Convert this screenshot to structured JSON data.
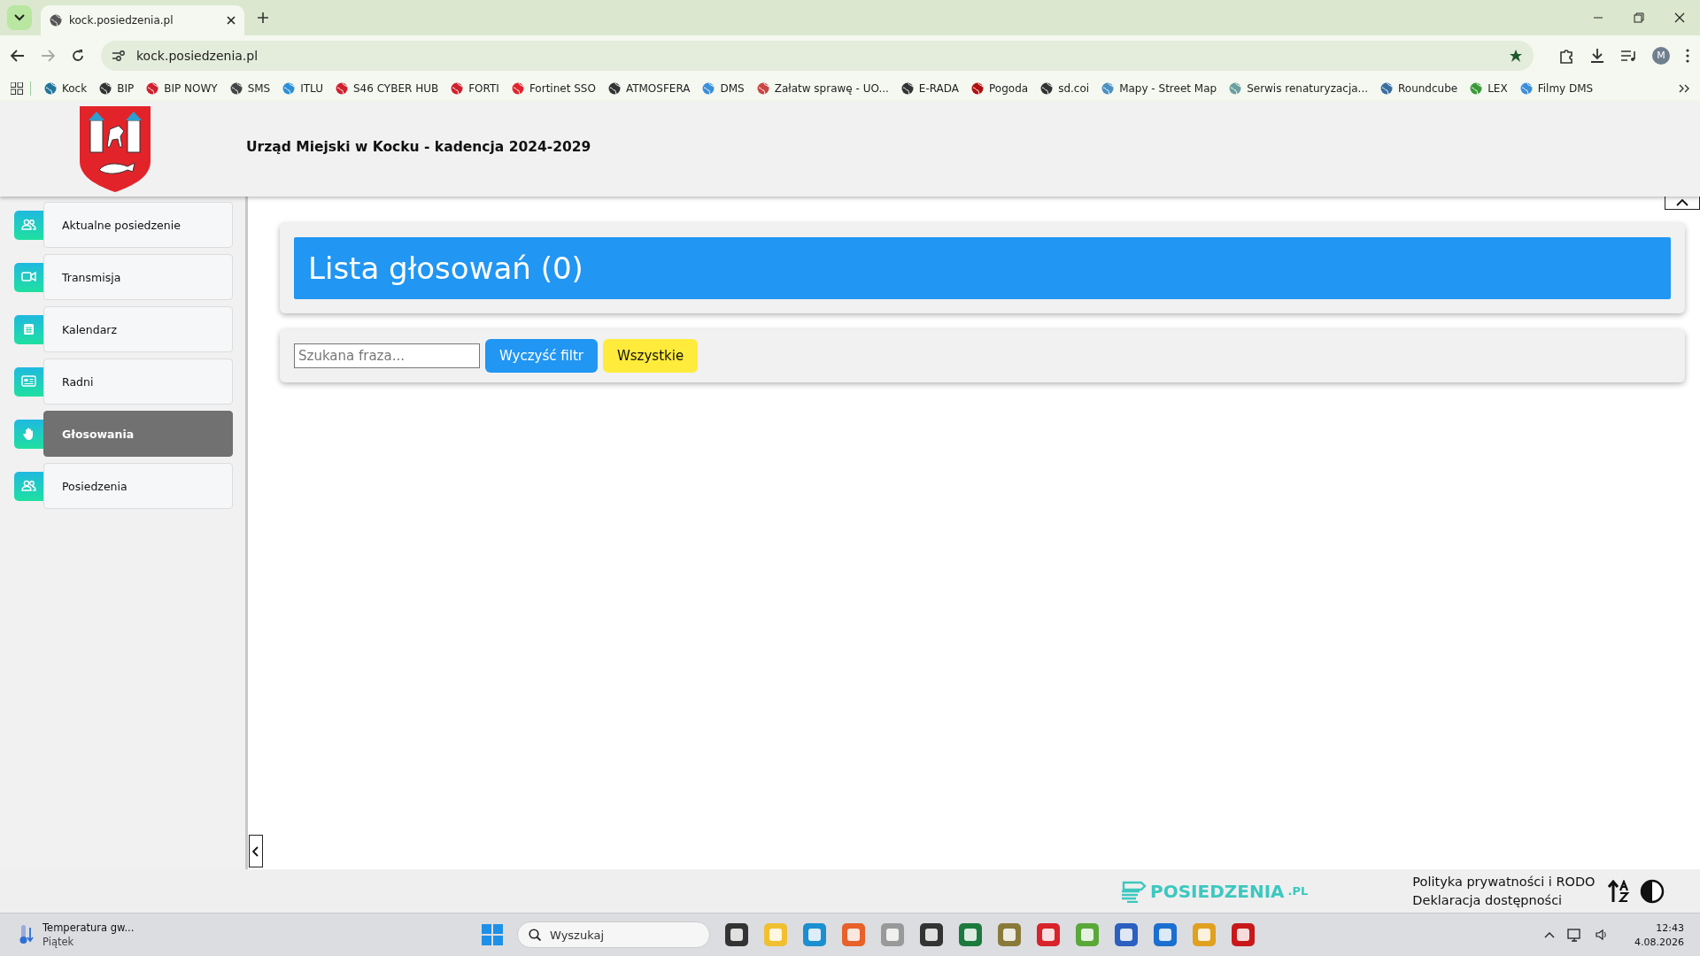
{
  "browser": {
    "tab_title": "kock.posiedzenia.pl",
    "address": "kock.posiedzenia.pl",
    "bookmarks": [
      {
        "label": "Kock"
      },
      {
        "label": "BIP"
      },
      {
        "label": "BIP NOWY"
      },
      {
        "label": "SMS"
      },
      {
        "label": "ITLU"
      },
      {
        "label": "S46 CYBER HUB"
      },
      {
        "label": "FORTI"
      },
      {
        "label": "Fortinet SSO"
      },
      {
        "label": "ATMOSFERA"
      },
      {
        "label": "DMS"
      },
      {
        "label": "Załatw sprawę - UO..."
      },
      {
        "label": "E-RADA"
      },
      {
        "label": "Pogoda"
      },
      {
        "label": "sd.coi"
      },
      {
        "label": "Mapy - Street Map"
      },
      {
        "label": "Serwis renaturyzacja..."
      },
      {
        "label": "Roundcube"
      },
      {
        "label": "LEX"
      },
      {
        "label": "Filmy DMS"
      }
    ],
    "profile_initial": "M"
  },
  "header": {
    "title": "Urząd Miejski w Kocku - kadencja 2024-2029"
  },
  "sidebar": {
    "items": [
      {
        "label": "Aktualne posiedzenie",
        "selected": false
      },
      {
        "label": "Transmisja",
        "selected": false
      },
      {
        "label": "Kalendarz",
        "selected": false
      },
      {
        "label": "Radni",
        "selected": false
      },
      {
        "label": "Głosowania",
        "selected": true
      },
      {
        "label": "Posiedzenia",
        "selected": false
      }
    ]
  },
  "main": {
    "title": "Lista głosowań (0)",
    "search": {
      "placeholder": "Szukana fraza..."
    },
    "buttons": [
      {
        "label": "Wyczyść filtr",
        "kind": "primary"
      },
      {
        "label": "Wszystkie",
        "kind": "warning"
      }
    ]
  },
  "footer": {
    "brand": "POSIEDZENIA",
    "brand_suffix": ".PL",
    "links": [
      "Polityka prywatności i RODO",
      "Deklaracja dostępności"
    ]
  },
  "taskbar": {
    "weather": {
      "title": "Temperatura gw...",
      "subtitle": "Piątek"
    },
    "search": {
      "placeholder": "Wyszukaj"
    },
    "clock": {
      "time": "12:43",
      "date": "4.08.2026"
    }
  }
}
